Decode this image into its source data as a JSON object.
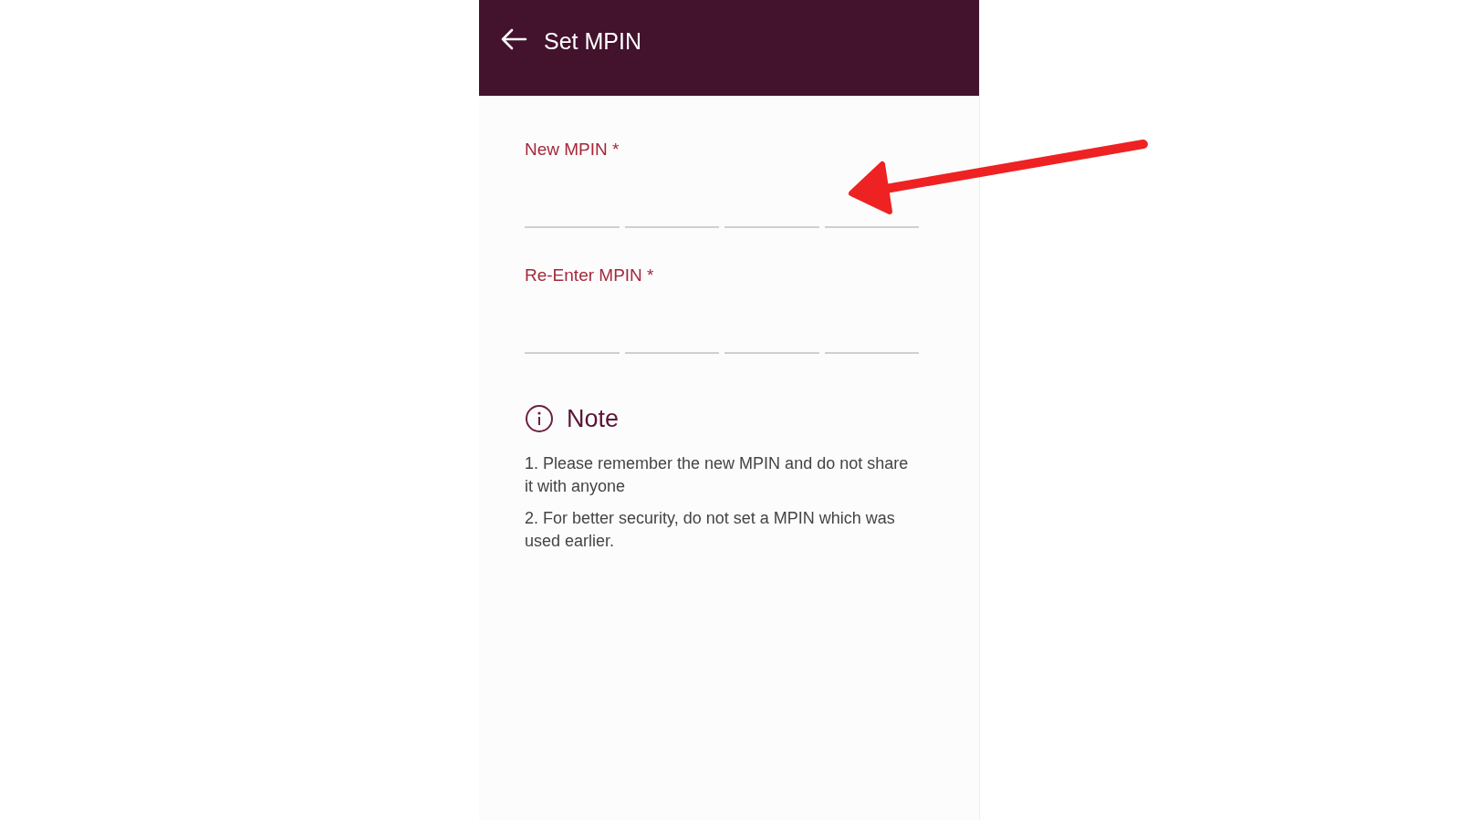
{
  "header": {
    "title": "Set MPIN"
  },
  "fields": [
    {
      "label": "New MPIN *"
    },
    {
      "label": "Re-Enter MPIN *"
    }
  ],
  "note": {
    "title": "Note",
    "items": [
      "1. Please remember the new MPIN and do not share it with anyone",
      "2. For better security, do not set a MPIN which was used earlier."
    ]
  }
}
